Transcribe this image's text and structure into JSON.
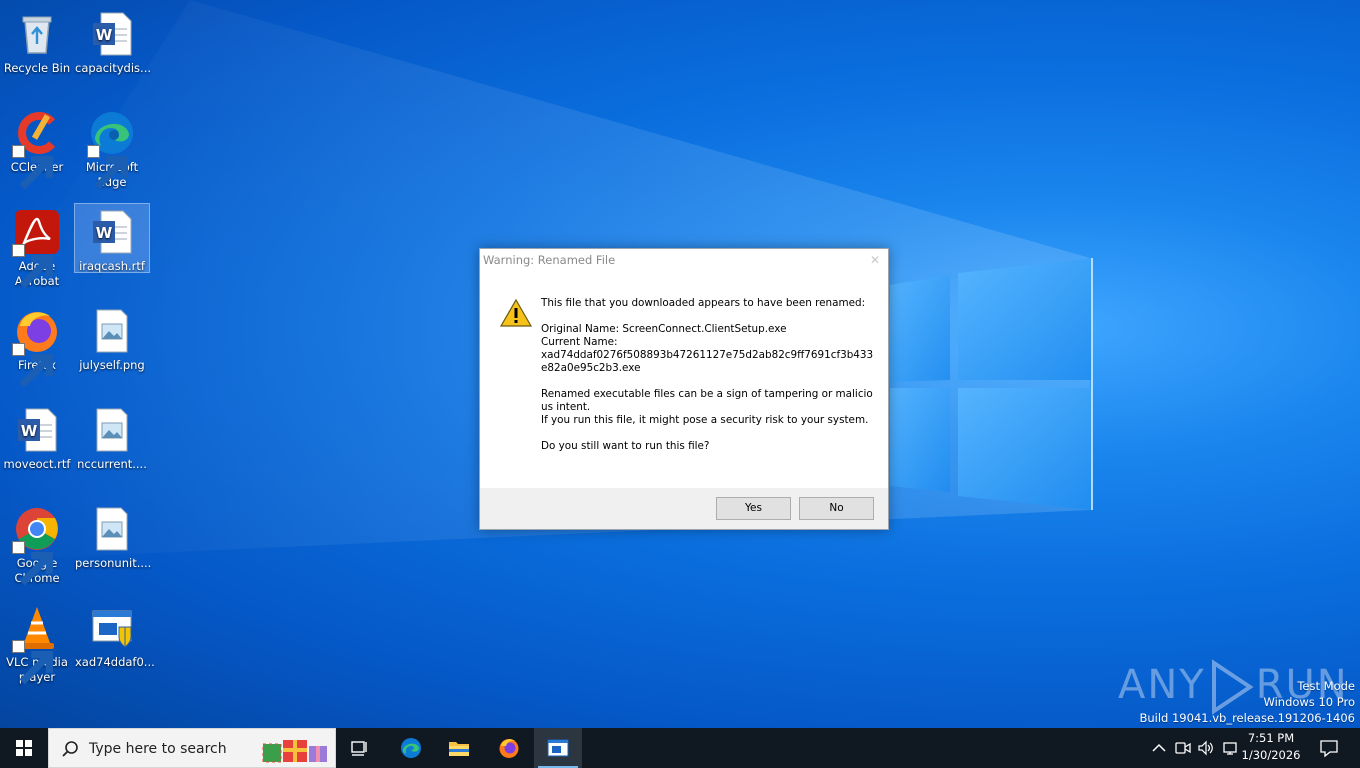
{
  "desktop": {
    "icons": [
      {
        "label": "Recycle Bin",
        "icon": "recycle-bin-icon"
      },
      {
        "label": "capacitydis...",
        "icon": "word-doc-icon"
      },
      {
        "label": "CCleaner",
        "icon": "ccleaner-icon"
      },
      {
        "label": "Microsoft Edge",
        "icon": "edge-icon"
      },
      {
        "label": "Adobe Acrobat",
        "icon": "acrobat-icon"
      },
      {
        "label": "iraqcash.rtf",
        "icon": "word-doc-icon"
      },
      {
        "label": "Firefox",
        "icon": "firefox-icon"
      },
      {
        "label": "julyself.png",
        "icon": "image-file-icon"
      },
      {
        "label": "moveoct.rtf",
        "icon": "word-doc-icon"
      },
      {
        "label": "nccurrent....",
        "icon": "image-file-icon"
      },
      {
        "label": "Google Chrome",
        "icon": "chrome-icon"
      },
      {
        "label": "personunit....",
        "icon": "image-file-icon"
      },
      {
        "label": "VLC media player",
        "icon": "vlc-icon"
      },
      {
        "label": "xad74ddaf0...",
        "icon": "installer-exe-icon"
      }
    ]
  },
  "dialog": {
    "title": "Warning: Renamed File",
    "close_glyph": "✕",
    "line1": "This file that you downloaded appears to have been renamed:",
    "original_name": "Original Name: ScreenConnect.ClientSetup.exe",
    "current_name_label": "Current Name:",
    "current_name_value": "xad74ddaf0276f508893b47261127e75d2ab82c9ff7691cf3b433e82a0e95c2b3.exe",
    "line_risk1": "Renamed executable files can be a sign of tampering or malicious intent.",
    "line_risk2": "If you run this file, it might pose a security risk to your system.",
    "question": "Do you still want to run this file?",
    "yes_label": "Yes",
    "no_label": "No"
  },
  "watermark": {
    "brand_left": "ANY",
    "brand_right": "RUN",
    "test_mode": "Test Mode",
    "edition": "Windows 10 Pro",
    "build": "Build 19041.vb_release.191206-1406"
  },
  "taskbar": {
    "search_placeholder": "Type here to search",
    "clock_time": "7:51 PM",
    "clock_date": "1/30/2026"
  },
  "colors": {
    "accent": "#0078d7",
    "taskbar": "#101922",
    "desktop_blue": "#0a64d6"
  }
}
